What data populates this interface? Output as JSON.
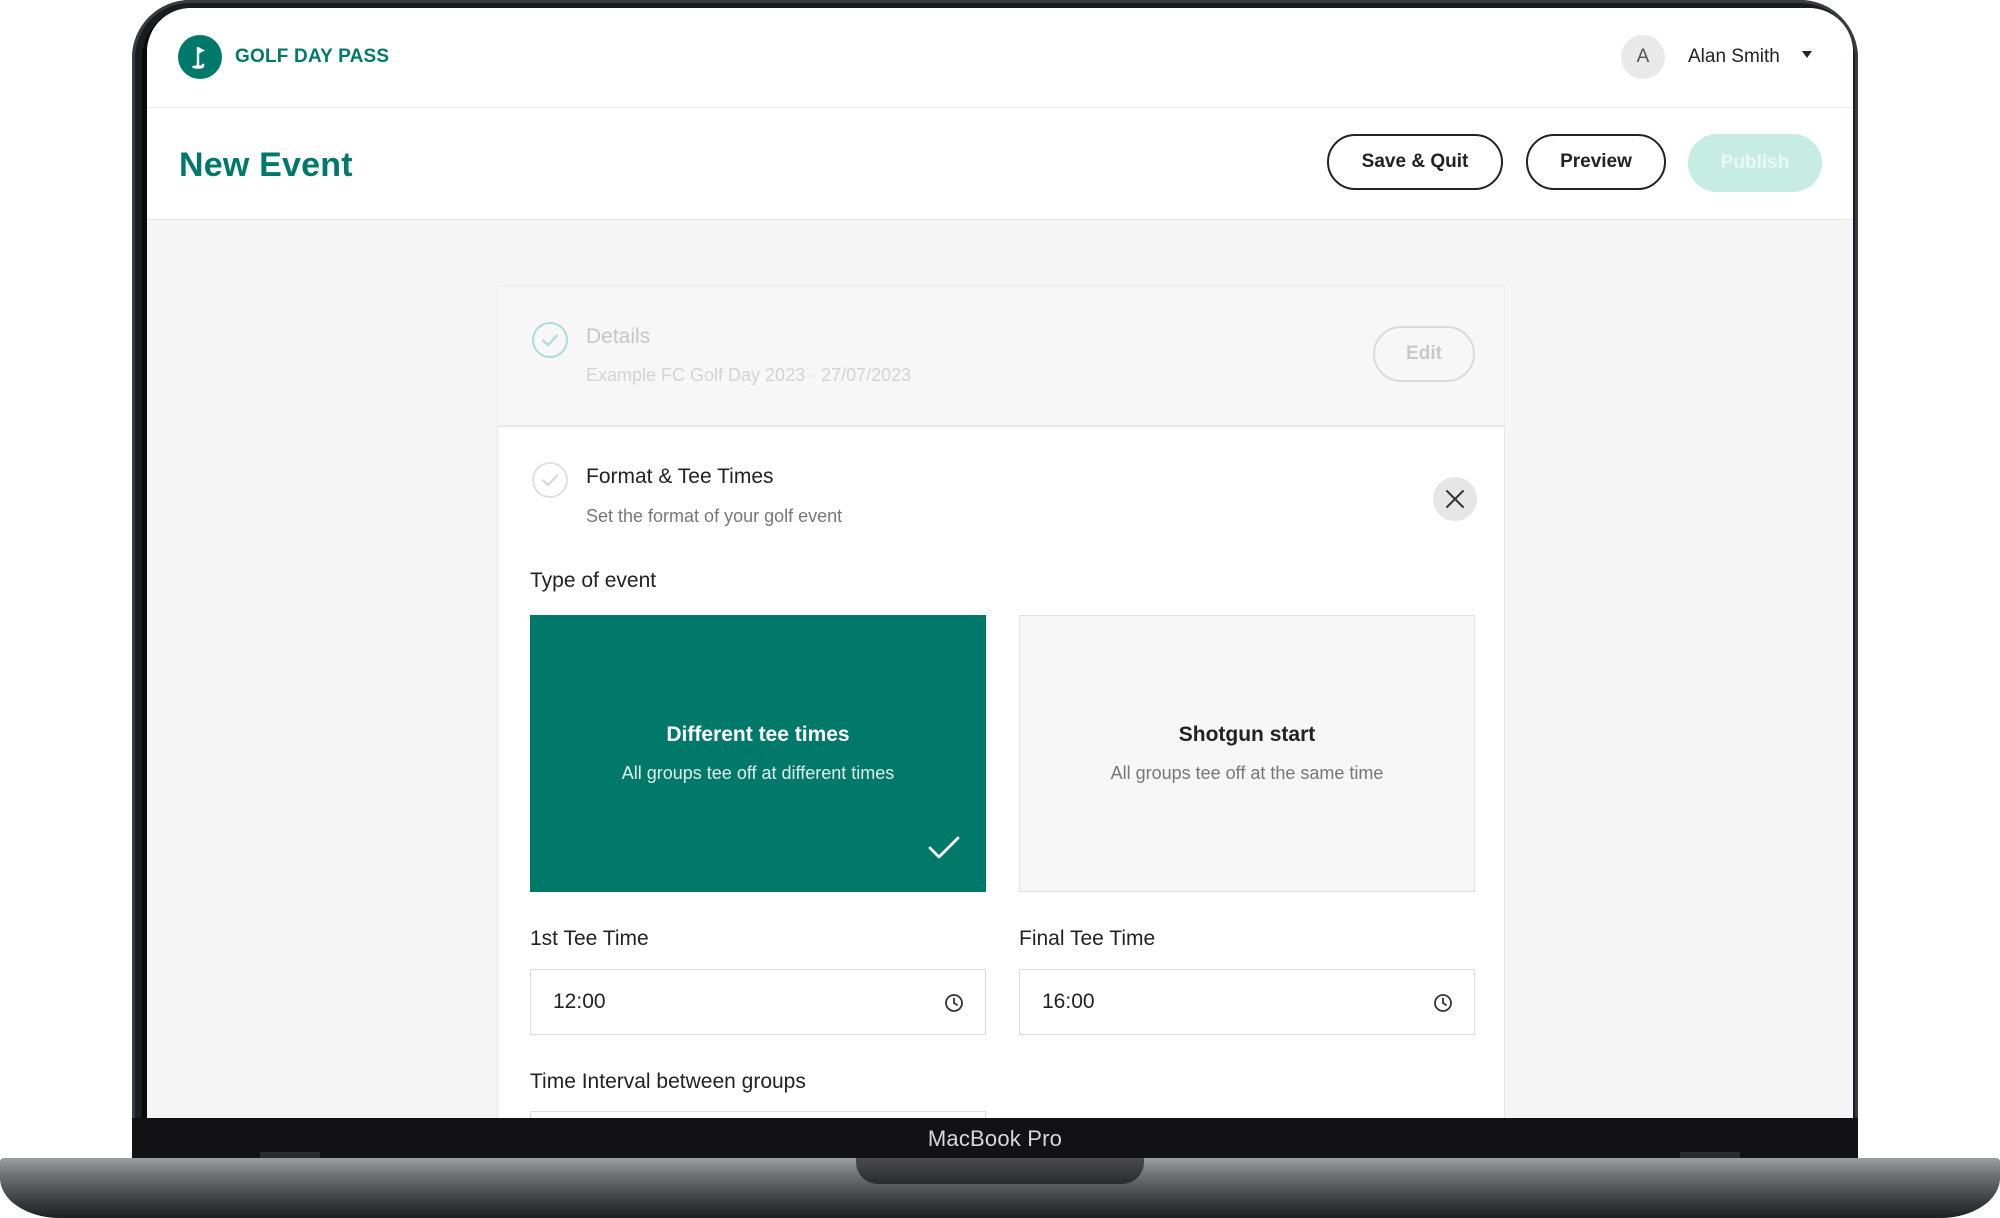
{
  "app": {
    "brand": "GOLF DAY PASS"
  },
  "user": {
    "avatar_initial": "A",
    "name": "Alan Smith"
  },
  "header": {
    "title": "New Event",
    "save_quit_label": "Save & Quit",
    "preview_label": "Preview",
    "publish_label": "Publish"
  },
  "details_step": {
    "title": "Details",
    "summary": "Example FC Golf Day 2023  ·  27/07/2023",
    "edit_label": "Edit"
  },
  "format_step": {
    "title": "Format & Tee Times",
    "subtitle": "Set the format of your golf event",
    "type_label": "Type of event",
    "options": [
      {
        "title": "Different tee times",
        "subtitle": "All groups tee off at different times",
        "selected": true
      },
      {
        "title": "Shotgun start",
        "subtitle": "All groups tee off at the same time",
        "selected": false
      }
    ],
    "first_tee_label": "1st Tee Time",
    "first_tee_value": "12:00",
    "final_tee_label": "Final Tee Time",
    "final_tee_value": "16:00",
    "interval_label": "Time Interval between groups"
  },
  "device": {
    "label": "MacBook Pro"
  },
  "colors": {
    "brand": "#00796b",
    "publish_disabled": "#c7ece4"
  },
  "icons": [
    "golf-flag-icon",
    "chevron-down-icon",
    "check-circle-icon",
    "close-icon",
    "checkmark-icon",
    "clock-icon"
  ]
}
